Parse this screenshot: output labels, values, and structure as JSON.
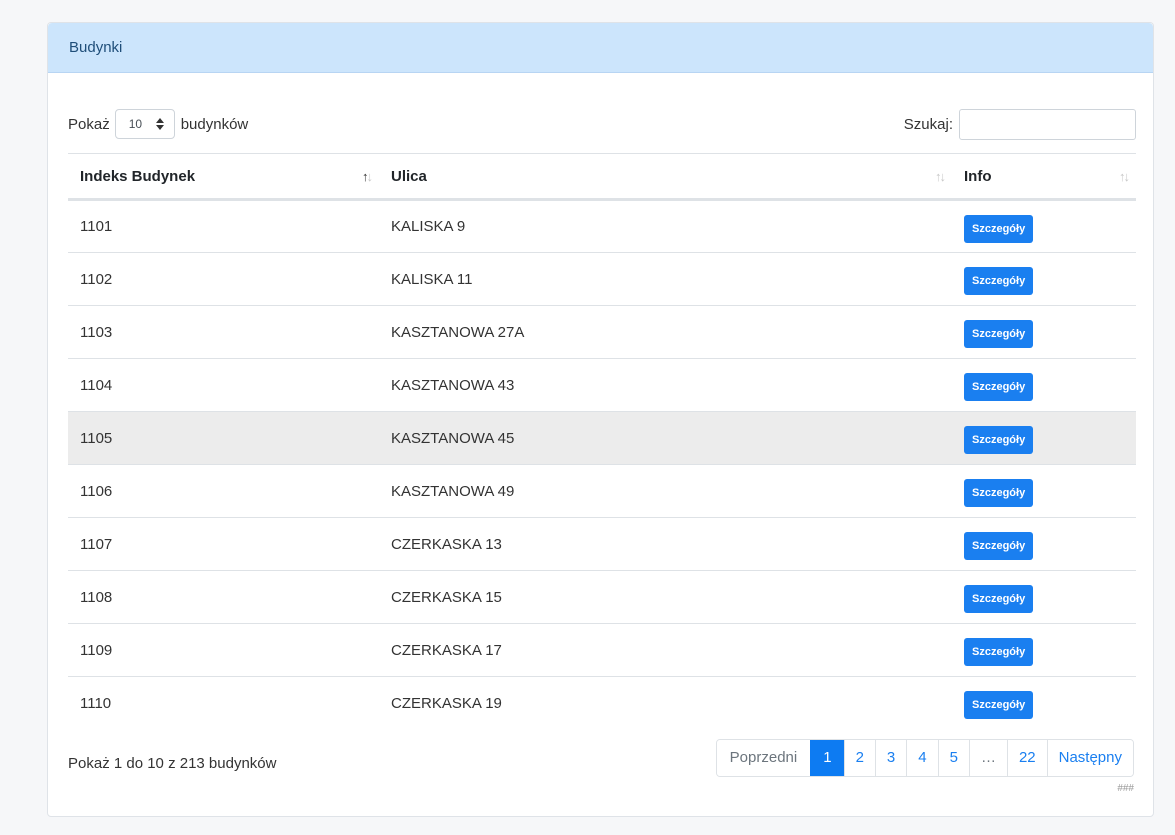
{
  "card": {
    "title": "Budynki"
  },
  "controls": {
    "show_label": "Pokaż",
    "length_value": "10",
    "length_suffix": "budynków",
    "search_label": "Szukaj:",
    "search_value": ""
  },
  "table": {
    "headers": [
      "Indeks Budynek",
      "Ulica",
      "Info"
    ],
    "rows": [
      {
        "id": "1101",
        "street": "KALISKA 9",
        "button": "Szczegóły"
      },
      {
        "id": "1102",
        "street": "KALISKA 11",
        "button": "Szczegóły"
      },
      {
        "id": "1103",
        "street": "KASZTANOWA 27A",
        "button": "Szczegóły"
      },
      {
        "id": "1104",
        "street": "KASZTANOWA 43",
        "button": "Szczegóły"
      },
      {
        "id": "1105",
        "street": "KASZTANOWA 45",
        "button": "Szczegóły"
      },
      {
        "id": "1106",
        "street": "KASZTANOWA 49",
        "button": "Szczegóły"
      },
      {
        "id": "1107",
        "street": "CZERKASKA 13",
        "button": "Szczegóły"
      },
      {
        "id": "1108",
        "street": "CZERKASKA 15",
        "button": "Szczegóły"
      },
      {
        "id": "1109",
        "street": "CZERKASKA 17",
        "button": "Szczegóły"
      },
      {
        "id": "1110",
        "street": "CZERKASKA 19",
        "button": "Szczegóły"
      }
    ]
  },
  "footer": {
    "info": "Pokaż 1 do 10 z 213 budynków",
    "pagination": [
      "Poprzedni",
      "1",
      "2",
      "3",
      "4",
      "5",
      "…",
      "22",
      "Następny"
    ],
    "active_page": "1",
    "hash": "###"
  },
  "icons": {
    "sort": "sort-arrows-icon",
    "select": "select-arrows-icon"
  },
  "colors": {
    "header_bg": "#cce5fc",
    "button": "#1a7ff0",
    "active_page": "#0d7bf2",
    "hover_row": "#ececec"
  }
}
